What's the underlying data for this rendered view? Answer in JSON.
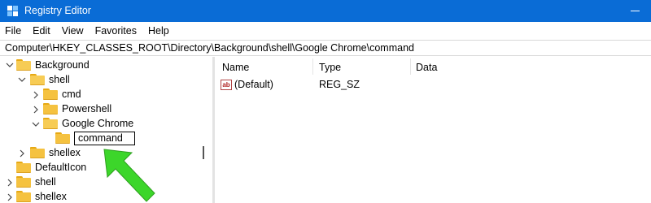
{
  "window": {
    "title": "Registry Editor"
  },
  "menu": [
    "File",
    "Edit",
    "View",
    "Favorites",
    "Help"
  ],
  "address": "Computer\\HKEY_CLASSES_ROOT\\Directory\\Background\\shell\\Google Chrome\\command",
  "tree": {
    "background": "Background",
    "shell": "shell",
    "cmd": "cmd",
    "powershell": "Powershell",
    "google_chrome": "Google Chrome",
    "command": "command",
    "shellex": "shellex",
    "defaulticon": "DefaultIcon",
    "shell2": "shell",
    "shellex2": "shellex"
  },
  "columns": {
    "name": "Name",
    "type": "Type",
    "data": "Data"
  },
  "values": [
    {
      "name": "(Default)",
      "type": "REG_SZ",
      "data": "",
      "icon": "string-value-icon"
    }
  ],
  "colors": {
    "titlebar": "#0a6cd6",
    "folder": "#f5c240",
    "arrow": "#3cd62a"
  }
}
